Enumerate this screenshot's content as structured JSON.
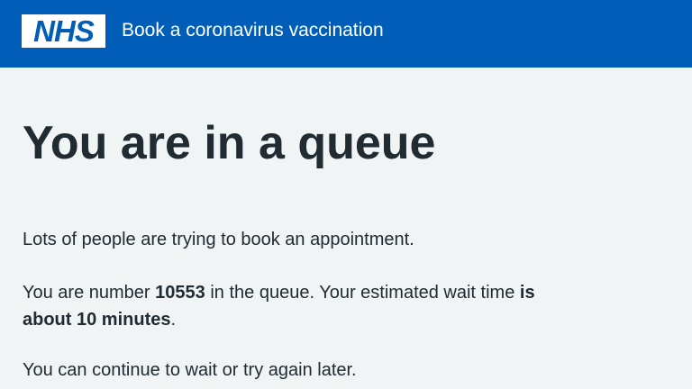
{
  "header": {
    "logo_text": "NHS",
    "service_name": "Book a coronavirus vaccination"
  },
  "main": {
    "title": "You are in a queue",
    "intro": "Lots of people are trying to book an appointment.",
    "queue": {
      "prefix": "You are number",
      "number": "10553",
      "middle": "in the queue. Your estimated wait time",
      "wait_bold_1": "is",
      "wait_bold_2": "about 10 minutes",
      "suffix": "."
    },
    "continue_text": "You can continue to wait or try again later."
  },
  "colors": {
    "nhs_blue": "#005eb8",
    "background": "#f0f4f5",
    "text": "#212b32"
  }
}
